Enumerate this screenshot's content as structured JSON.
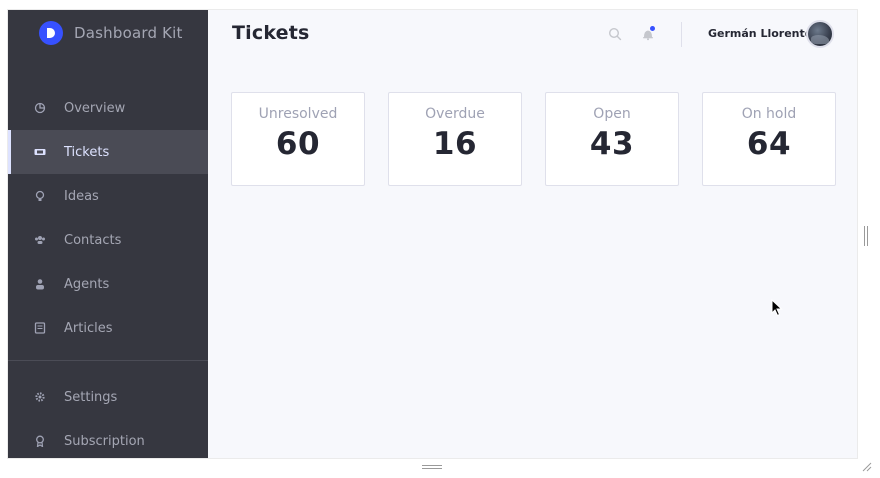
{
  "app": {
    "brand_name": "Dashboard Kit"
  },
  "sidebar": {
    "items": [
      {
        "label": "Overview",
        "icon": "pie-chart-icon"
      },
      {
        "label": "Tickets",
        "icon": "ticket-icon",
        "active": true
      },
      {
        "label": "Ideas",
        "icon": "lightbulb-icon"
      },
      {
        "label": "Contacts",
        "icon": "contacts-icon"
      },
      {
        "label": "Agents",
        "icon": "agent-icon"
      },
      {
        "label": "Articles",
        "icon": "book-icon"
      }
    ],
    "bottom_items": [
      {
        "label": "Settings",
        "icon": "gear-icon"
      },
      {
        "label": "Subscription",
        "icon": "award-icon"
      }
    ]
  },
  "header": {
    "title": "Tickets",
    "user_name": "Germán Llorente"
  },
  "cards": [
    {
      "label": "Unresolved",
      "value": "60"
    },
    {
      "label": "Overdue",
      "value": "16"
    },
    {
      "label": "Open",
      "value": "43"
    },
    {
      "label": "On hold",
      "value": "64"
    }
  ],
  "colors": {
    "sidebar_bg": "#363740",
    "accent": "#3751ff",
    "active_item_bg": "#4a4b55",
    "text_dark": "#252733",
    "text_muted": "#9fa2b4"
  }
}
